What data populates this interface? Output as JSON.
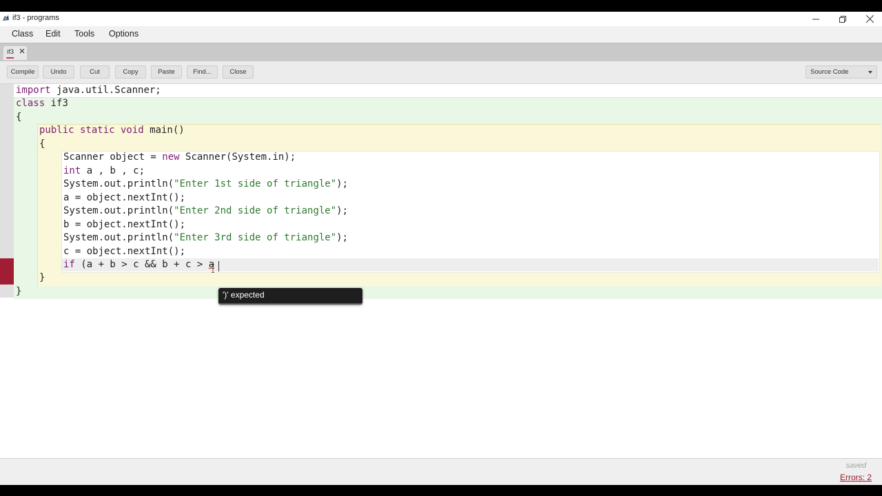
{
  "window": {
    "title": "if3 - programs"
  },
  "menu": [
    "Class",
    "Edit",
    "Tools",
    "Options"
  ],
  "tab": {
    "label": "if3"
  },
  "toolbar": {
    "buttons": [
      "Compile",
      "Undo",
      "Cut",
      "Copy",
      "Paste",
      "Find...",
      "Close"
    ],
    "view_select": "Source Code"
  },
  "code": {
    "l1_kw": "import",
    "l1_rest": " java.util.Scanner;",
    "l2_kw": "class",
    "l2_rest": " if3",
    "l3": "{",
    "l4_kw": "public static void",
    "l4_rest": " main()",
    "l5": "{",
    "l6_a": "Scanner object = ",
    "l6_kw": "new",
    "l6_b": " Scanner(System.in);",
    "l7_kw": "int",
    "l7_rest": " a , b , c;",
    "l8_a": "System.out.println(",
    "l8_str": "\"Enter 1st side of triangle\"",
    "l8_b": ");",
    "l9": "a = object.nextInt();",
    "l10_a": "System.out.println(",
    "l10_str": "\"Enter 2nd side of triangle\"",
    "l10_b": ");",
    "l11": "b = object.nextInt();",
    "l12_a": "System.out.println(",
    "l12_str": "\"Enter 3rd side of triangle\"",
    "l12_b": ");",
    "l13": "c = object.nextInt();",
    "l14_kw": "if",
    "l14_rest": " (a + b > c && b + c > ",
    "l14_err": "a",
    "l15": "}",
    "l16": "}"
  },
  "error_tooltip": "')' expected",
  "status": {
    "saved": "saved",
    "errors": "Errors: 2"
  },
  "colors": {
    "keyword": "#7a1c72",
    "string": "#2f7a2f",
    "error_gutter": "#a11d34",
    "class_scope": "#e9f7e6",
    "method_scope": "#fbf8d9"
  }
}
